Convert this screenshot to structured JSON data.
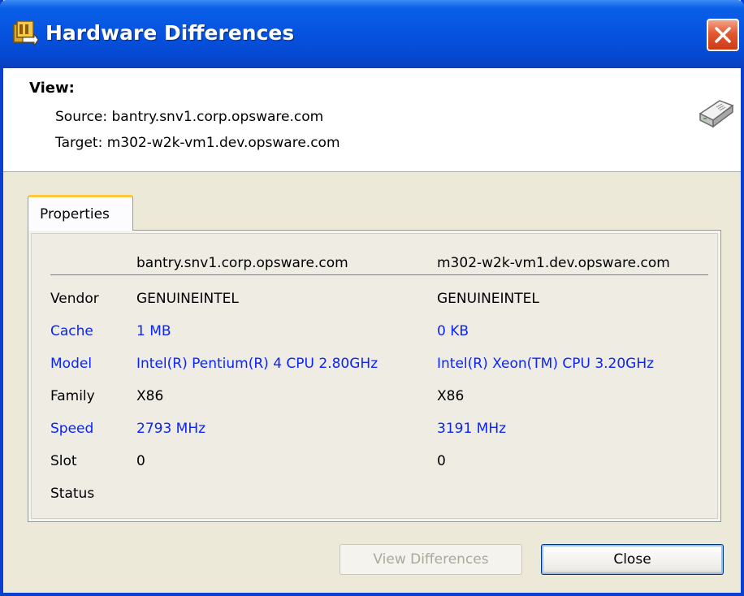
{
  "window": {
    "title": "Hardware Differences"
  },
  "view": {
    "heading": "View:",
    "source": "Source: bantry.snv1.corp.opsware.com",
    "target": "Target: m302-w2k-vm1.dev.opsware.com"
  },
  "tabs": [
    {
      "label": "Properties",
      "selected": true
    }
  ],
  "table": {
    "columns": [
      "bantry.snv1.corp.opsware.com",
      "m302-w2k-vm1.dev.opsware.com"
    ],
    "rows": [
      {
        "label": "Vendor",
        "source": "GENUINEINTEL",
        "target": "GENUINEINTEL",
        "differs": false
      },
      {
        "label": "Cache",
        "source": "1 MB",
        "target": "0 KB",
        "differs": true
      },
      {
        "label": "Model",
        "source": "Intel(R) Pentium(R) 4 CPU 2.80GHz",
        "target": "Intel(R) Xeon(TM) CPU 3.20GHz",
        "differs": true
      },
      {
        "label": "Family",
        "source": "X86",
        "target": "X86",
        "differs": false
      },
      {
        "label": "Speed",
        "source": "2793 MHz",
        "target": "3191 MHz",
        "differs": true
      },
      {
        "label": "Slot",
        "source": "0",
        "target": "0",
        "differs": false
      },
      {
        "label": "Status",
        "source": "",
        "target": "",
        "differs": false
      }
    ]
  },
  "buttons": {
    "view_differences": {
      "label": "View Differences",
      "enabled": false
    },
    "close": {
      "label": "Close",
      "enabled": true
    }
  },
  "colors": {
    "title_bar": "#0553e0",
    "difference_text": "#0b24fb",
    "tab_highlight": "#ffc83c",
    "dialog_background": "#ece9d8"
  },
  "icons": {
    "title": "hardware-compare-icon",
    "close": "close-icon",
    "server": "server-icon"
  }
}
